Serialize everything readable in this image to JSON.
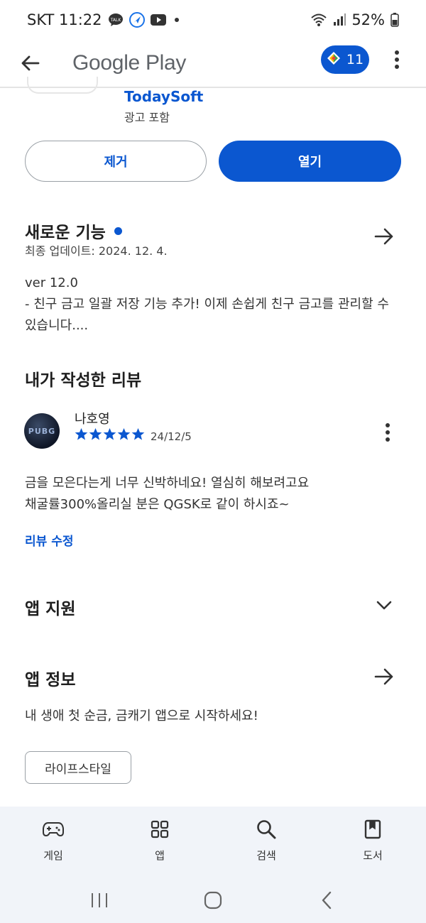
{
  "status_bar": {
    "carrier_time": "SKT 11:22",
    "battery": "52%",
    "icons": [
      "talk-icon",
      "navigation-icon",
      "youtube-icon",
      "wifi-icon",
      "signal-icon",
      "battery-icon"
    ]
  },
  "app_bar": {
    "title": "Google Play",
    "points_count": "11",
    "icons": [
      "back-arrow-icon",
      "play-points-icon",
      "more-vert-icon"
    ]
  },
  "app_header": {
    "developer": "TodaySoft",
    "ads_label": "광고 포함"
  },
  "actions": {
    "remove_label": "제거",
    "open_label": "열기"
  },
  "whats_new": {
    "title": "새로운 기능",
    "updated": "최종 업데이트: 2024. 12. 4.",
    "version": "ver 12.0",
    "line1": "- 친구 금고 일괄 저장 기능 추가! 이제 손쉽게 친구 금고를 관리할 수",
    "line2": "있습니다...."
  },
  "my_review": {
    "section_title": "내가 작성한 리뷰",
    "avatar_text": "PUBG",
    "reviewer": "나호영",
    "rating": 5,
    "date": "24/12/5",
    "text_line1": "금을 모은다는게 너무 신박하네요! 열심히 해보려고요",
    "text_line2": "채굴률300%올리실 분은 QGSK로 같이 하시죠~",
    "edit_label": "리뷰 수정"
  },
  "app_support": {
    "title": "앱 지원"
  },
  "app_info": {
    "title": "앱 정보",
    "description": "내 생애 첫 순금, 금캐기 앱으로 시작하세요!",
    "category_chip": "라이프스타일"
  },
  "bottom_nav": {
    "items": [
      {
        "label": "게임",
        "icon": "gamepad-icon"
      },
      {
        "label": "앱",
        "icon": "apps-grid-icon"
      },
      {
        "label": "검색",
        "icon": "search-icon"
      },
      {
        "label": "도서",
        "icon": "book-icon"
      }
    ]
  },
  "colors": {
    "accent": "#0b57d0",
    "nav_background": "#f1f4f9"
  }
}
